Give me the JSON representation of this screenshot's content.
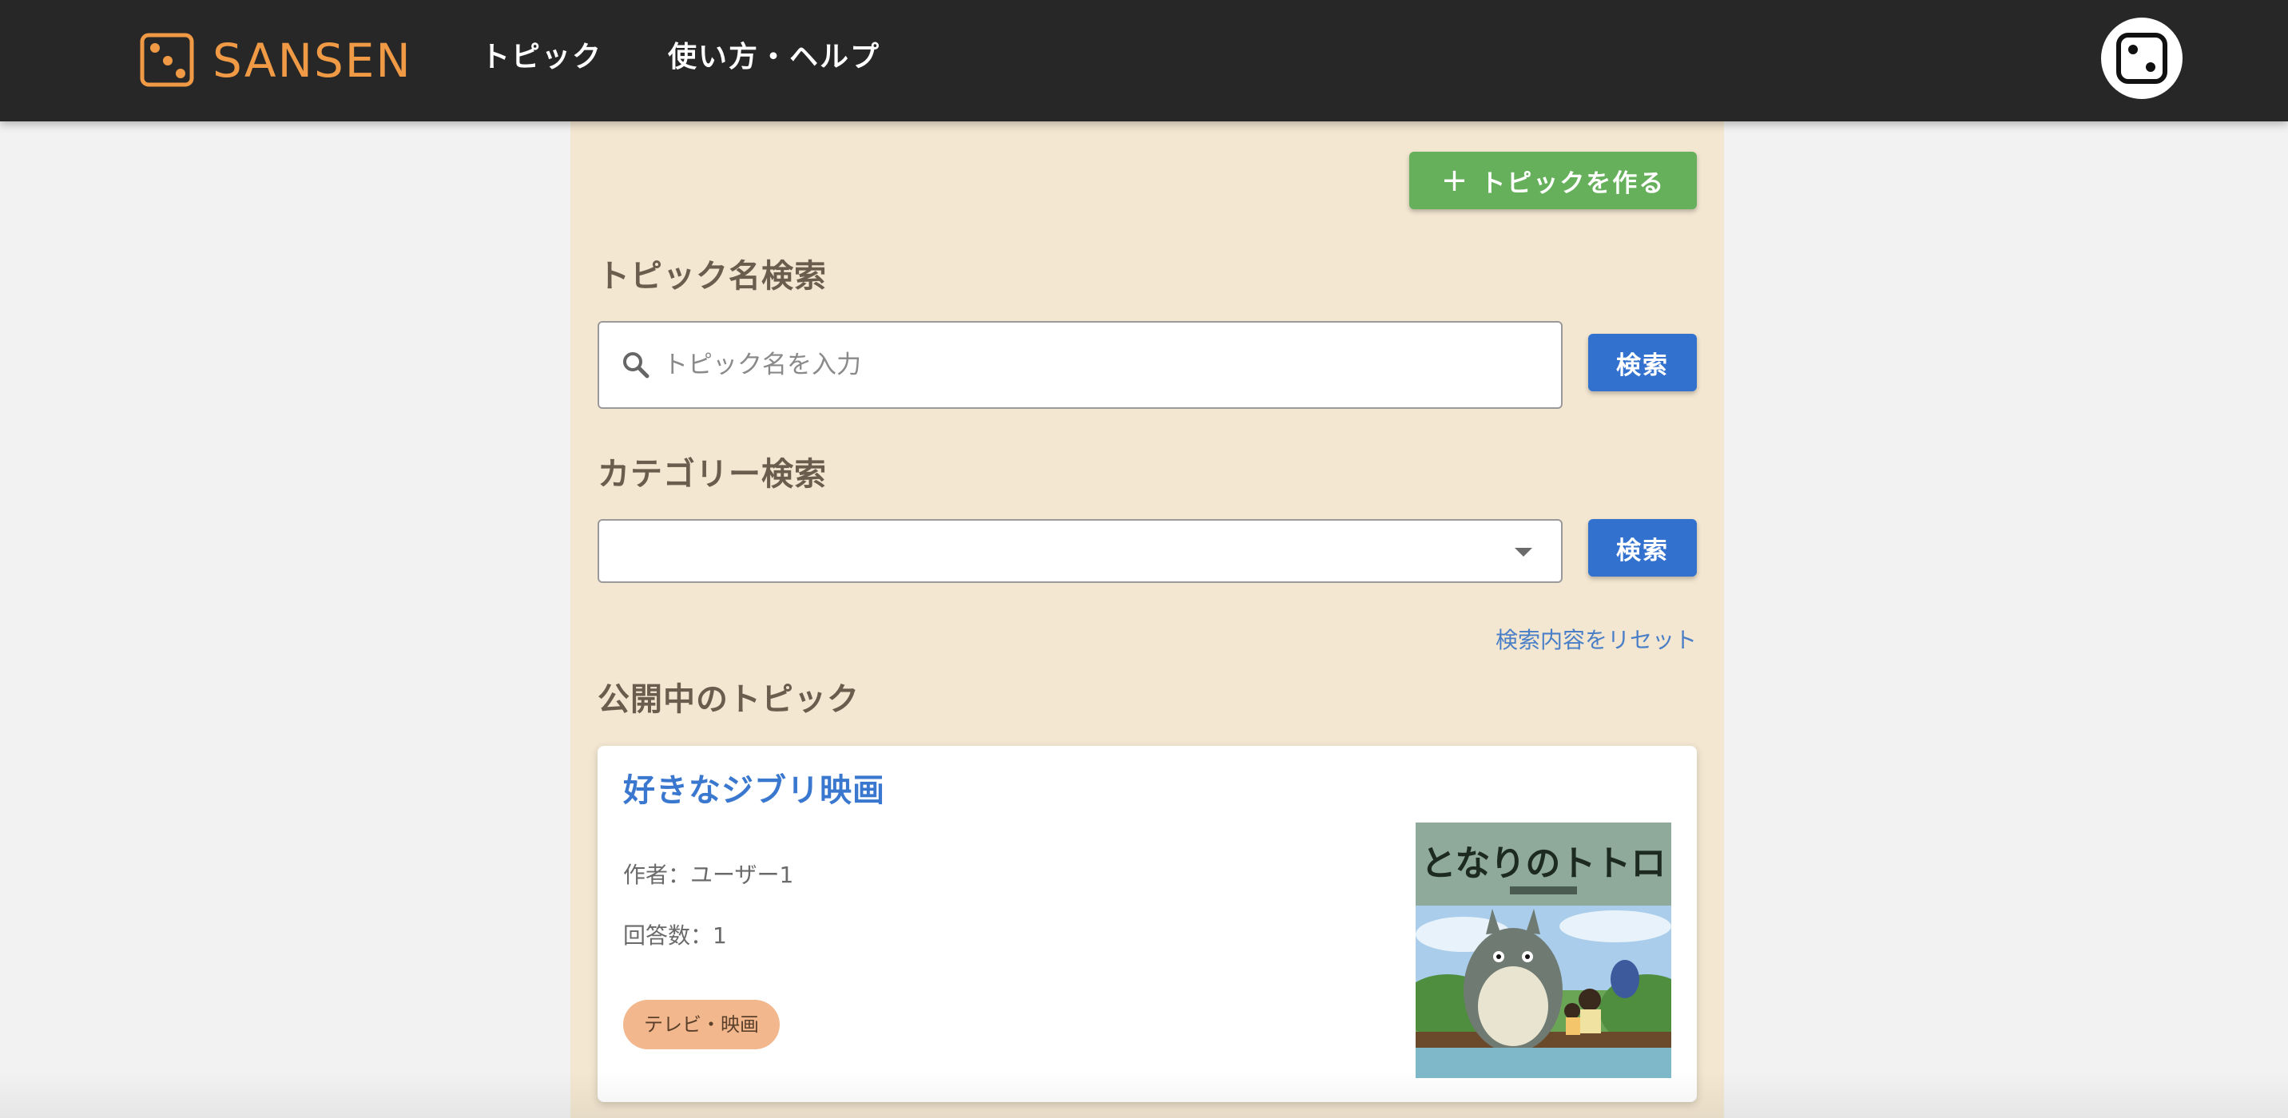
{
  "header": {
    "logo_text": "SANSEN",
    "nav": [
      {
        "label": "トピック"
      },
      {
        "label": "使い方・ヘルプ"
      }
    ],
    "avatar_icon": "dice-icon"
  },
  "toolbar": {
    "create_topic_label": "トピックを作る",
    "create_topic_icon": "plus-icon"
  },
  "topic_search": {
    "title": "トピック名検索",
    "placeholder": "トピック名を入力",
    "value": "",
    "button_label": "検索"
  },
  "category_search": {
    "title": "カテゴリー検索",
    "selected": "",
    "button_label": "検索"
  },
  "reset_label": "検索内容をリセット",
  "public_topics": {
    "title": "公開中のトピック",
    "items": [
      {
        "title": "好きなジブリ映画",
        "author": "作者：ユーザー1",
        "answers": "回答数：1",
        "category": "テレビ・映画",
        "thumbnail_text": "となりのトトロ"
      }
    ]
  },
  "colors": {
    "header_bg": "#272727",
    "brand": "#f09a45",
    "panel_bg": "#f3e7d1",
    "create_button": "#66b05c",
    "search_button": "#3371cf",
    "link": "#3a78cf",
    "chip": "#f2b78c"
  }
}
